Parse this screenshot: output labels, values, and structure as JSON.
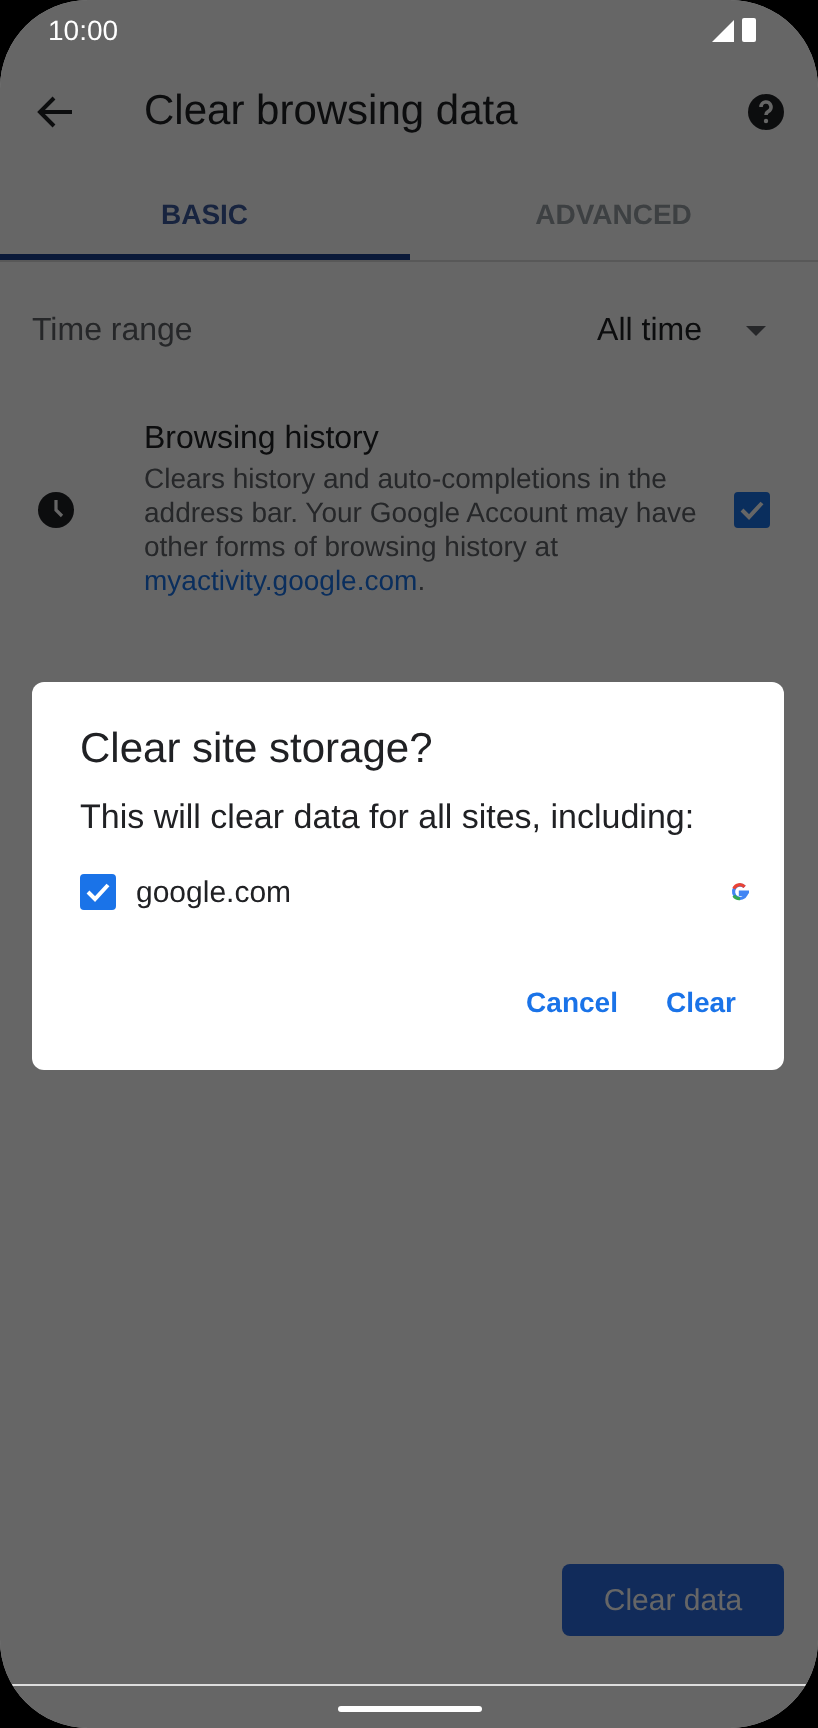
{
  "status_bar": {
    "time": "10:00"
  },
  "toolbar": {
    "title": "Clear browsing data"
  },
  "tabs": [
    {
      "label": "BASIC",
      "selected": true
    },
    {
      "label": "ADVANCED",
      "selected": false
    }
  ],
  "time_range": {
    "label": "Time range",
    "value": "All time"
  },
  "items": [
    {
      "title": "Browsing history",
      "description": "Clears history and auto-completions in the address bar. Your Google Account may have other forms of browsing history at ",
      "link": "myactivity.google.com",
      "after_link": ".",
      "checked": true
    }
  ],
  "dialog": {
    "title": "Clear site storage?",
    "message": "This will clear data for all sites, including:",
    "sites": [
      {
        "label": "google.com",
        "checked": true
      }
    ],
    "buttons": [
      "Cancel",
      "Clear"
    ]
  },
  "footer_button": "Clear data"
}
